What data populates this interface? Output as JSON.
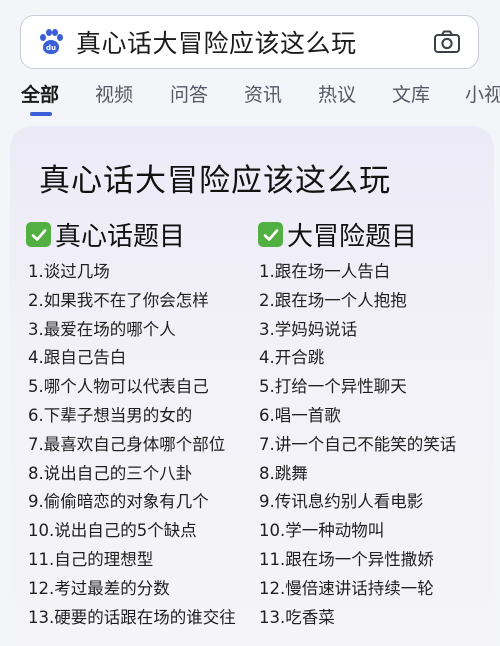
{
  "search": {
    "query": "真心话大冒险应该这么玩",
    "logo_icon": "baidu-paw-icon",
    "camera_icon": "camera-icon"
  },
  "tabs": [
    {
      "label": "全部",
      "active": true
    },
    {
      "label": "视频",
      "active": false
    },
    {
      "label": "问答",
      "active": false
    },
    {
      "label": "资讯",
      "active": false
    },
    {
      "label": "热议",
      "active": false
    },
    {
      "label": "文库",
      "active": false
    },
    {
      "label": "小视",
      "active": false
    }
  ],
  "card": {
    "title": "真心话大冒险应该这么玩",
    "truth": {
      "heading": "真心话题目",
      "items": [
        "1.谈过几场",
        "2.如果我不在了你会怎样",
        "3.最爱在场的哪个人",
        "4.跟自己告白",
        "5.哪个人物可以代表自己",
        "6.下辈子想当男的女的",
        "7.最喜欢自己身体哪个部位",
        "8.说出自己的三个八卦",
        "9.偷偷暗恋的对象有几个",
        "10.说出自己的5个缺点",
        "11.自己的理想型",
        "12.考过最差的分数",
        "13.硬要的话跟在场的谁交往"
      ]
    },
    "dare": {
      "heading": "大冒险题目",
      "items": [
        "1.跟在场一人告白",
        "2.跟在场一个人抱抱",
        "3.学妈妈说话",
        "4.开合跳",
        "5.打给一个异性聊天",
        "6.唱一首歌",
        "7.讲一个自己不能笑的笑话",
        "8.跳舞",
        "9.传讯息约别人看电影",
        "10.学一种动物叫",
        "11.跟在场一个异性撒娇",
        "12.慢倍速讲话持续一轮",
        "13.吃香菜"
      ]
    }
  },
  "colors": {
    "accent": "#3a5fd6",
    "check_green": "#52b043"
  }
}
